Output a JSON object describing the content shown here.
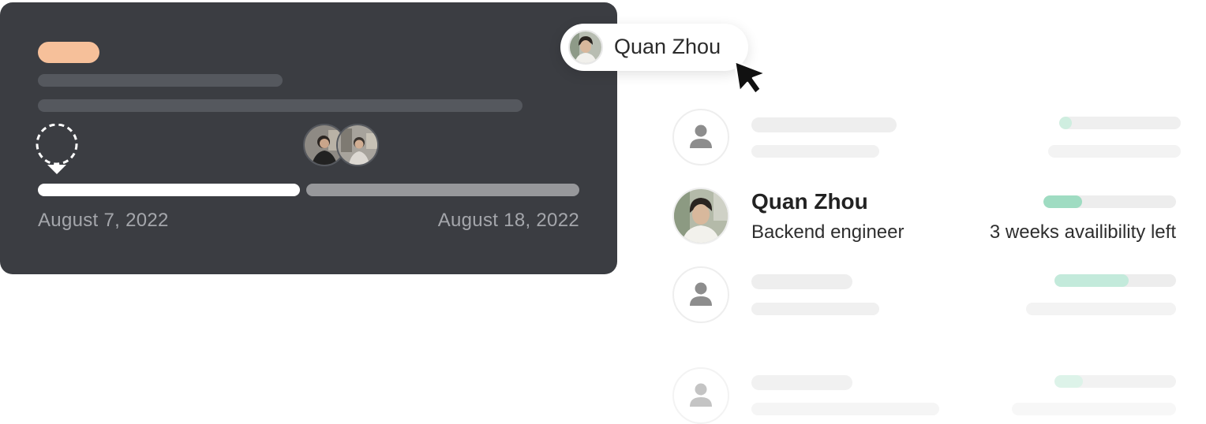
{
  "project_card": {
    "tag_color": "#f6c09a",
    "start_date": "August 7, 2022",
    "end_date": "August 18, 2022",
    "progress_fraction": 0.49,
    "assigned_avatars": [
      "person-photo-avatar",
      "person-photo-avatar"
    ]
  },
  "tooltip": {
    "name": "Quan Zhou",
    "avatar": "person-photo-avatar"
  },
  "people_list": {
    "accent_color": "#9fdcc2",
    "rows": [
      {
        "placeholder": true,
        "availability_fraction": 0.1
      },
      {
        "placeholder": false,
        "name": "Quan Zhou",
        "role": "Backend engineer",
        "availability": "3 weeks availibility left",
        "availability_fraction": 0.29
      },
      {
        "placeholder": true,
        "availability_fraction": 0.61
      },
      {
        "placeholder": true,
        "availability_fraction": 0.24
      }
    ]
  }
}
